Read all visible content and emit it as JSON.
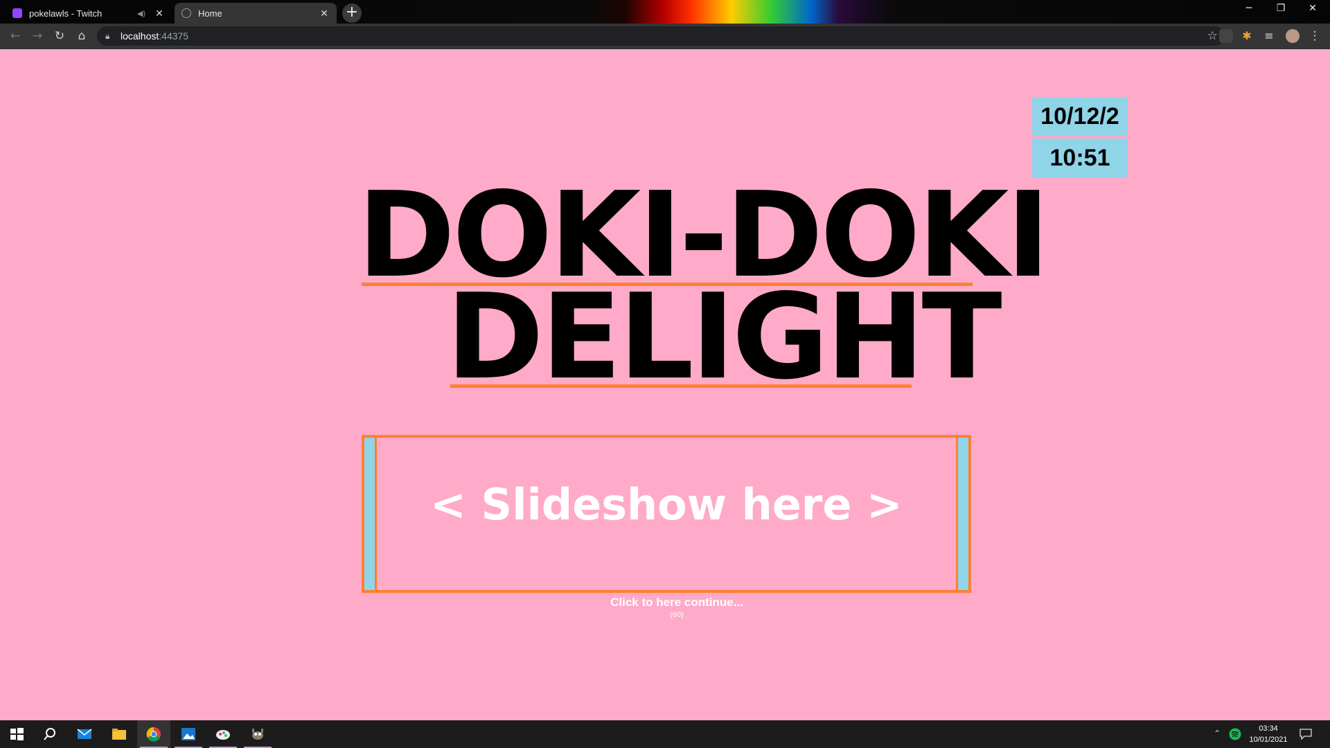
{
  "browser": {
    "tabs": [
      {
        "title": "pokelawls - Twitch",
        "favicon": "twitch-icon",
        "audio": "speaker-icon"
      },
      {
        "title": "Home",
        "favicon": "globe-icon"
      }
    ],
    "new_tab": "+",
    "address": {
      "host": "localhost",
      "port": ":44375"
    },
    "window_controls": {
      "minimize": "─",
      "restore": "❐",
      "close": "✕"
    }
  },
  "page": {
    "date": "10/12/2",
    "time": "10:51",
    "title_line1": "DOKI-DOKI",
    "title_line2": "DELIGHT",
    "slideshow_text": "< Slideshow here >",
    "continue_text": "Click to here continue...",
    "countdown": "(60)"
  },
  "taskbar": {
    "clock_time": "03:34",
    "clock_date": "10/01/2021"
  },
  "colors": {
    "page_background": "#ffaac8",
    "accent_orange": "#ff8030",
    "accent_blue": "#90d4e8"
  }
}
